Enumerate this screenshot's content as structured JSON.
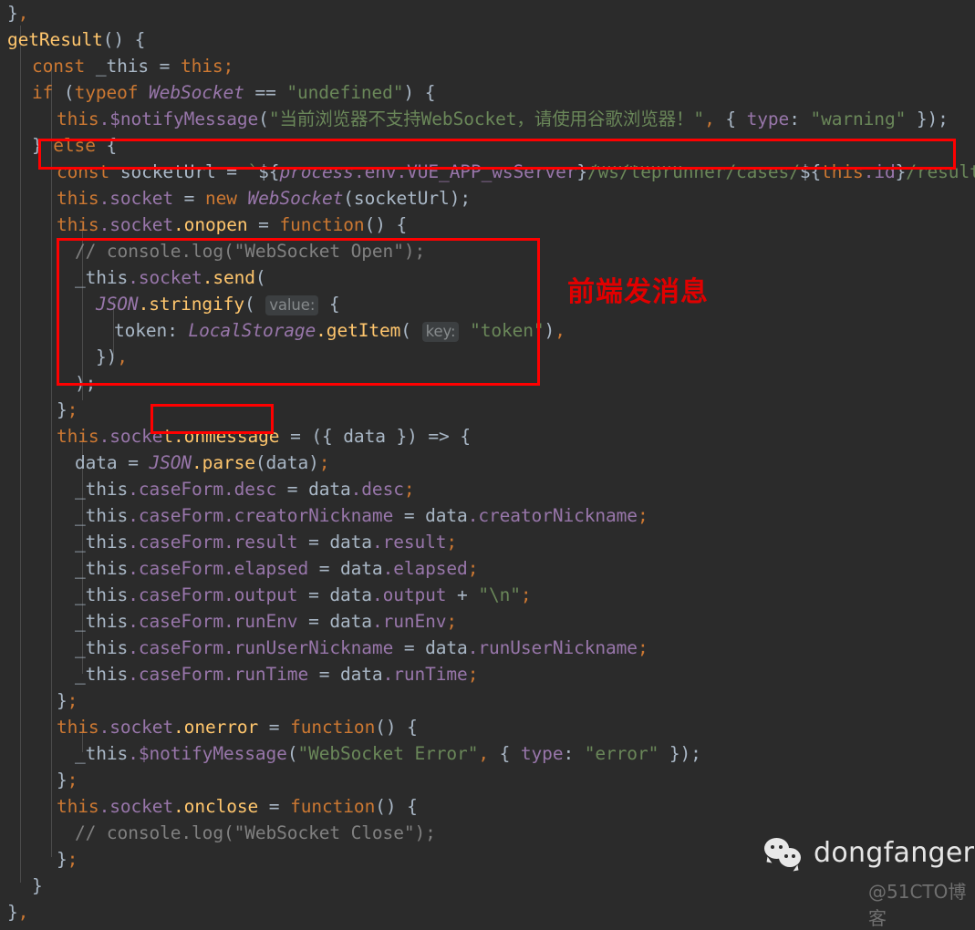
{
  "editor": {
    "background": "#2b2b2b",
    "default_text_color": "#a9b7c6",
    "language": "javascript"
  },
  "code_lines": [
    {
      "id": "l1",
      "text": "},",
      "indent": 0
    },
    {
      "id": "l2",
      "text": "getResult() {",
      "indent": 0
    },
    {
      "id": "l3",
      "text": "const _this = this;",
      "indent": 1
    },
    {
      "id": "l4",
      "text": "if (typeof WebSocket == \"undefined\") {",
      "indent": 1
    },
    {
      "id": "l5",
      "text": "this.$notifyMessage(\"当前浏览器不支持WebSocket，请使用谷歌浏览器！\", { type: \"warning\" });",
      "indent": 2
    },
    {
      "id": "l6",
      "text": "} else {",
      "indent": 1
    },
    {
      "id": "l7",
      "text": "const socketUrl = `${process.env.VUE_APP_wsServer}/ws/teprunner/cases/${this.id}/result/`;",
      "indent": 2
    },
    {
      "id": "l8",
      "text": "this.socket = new WebSocket(socketUrl);",
      "indent": 2
    },
    {
      "id": "l9",
      "text": "this.socket.onopen = function() {",
      "indent": 2
    },
    {
      "id": "l10",
      "text": "// console.log(\"WebSocket Open\");",
      "indent": 3
    },
    {
      "id": "l11",
      "text": "_this.socket.send(",
      "indent": 3
    },
    {
      "id": "l12",
      "text": "JSON.stringify( value: {",
      "indent": 4
    },
    {
      "id": "l13",
      "text": "token: LocalStorage.getItem( key: \"token\"),",
      "indent": 5
    },
    {
      "id": "l14",
      "text": "}),",
      "indent": 4
    },
    {
      "id": "l15",
      "text": ");",
      "indent": 3
    },
    {
      "id": "l16",
      "text": "};",
      "indent": 2
    },
    {
      "id": "l17",
      "text": "this.socket.onmessage = ({ data }) => {",
      "indent": 2
    },
    {
      "id": "l18",
      "text": "data = JSON.parse(data);",
      "indent": 3
    },
    {
      "id": "l19",
      "text": "_this.caseForm.desc = data.desc;",
      "indent": 3
    },
    {
      "id": "l20",
      "text": "_this.caseForm.creatorNickname = data.creatorNickname;",
      "indent": 3
    },
    {
      "id": "l21",
      "text": "_this.caseForm.result = data.result;",
      "indent": 3
    },
    {
      "id": "l22",
      "text": "_this.caseForm.elapsed = data.elapsed;",
      "indent": 3
    },
    {
      "id": "l23",
      "text": "_this.caseForm.output = data.output + \"\\n\";",
      "indent": 3
    },
    {
      "id": "l24",
      "text": "_this.caseForm.runEnv = data.runEnv;",
      "indent": 3
    },
    {
      "id": "l25",
      "text": "_this.caseForm.runUserNickname = data.runUserNickname;",
      "indent": 3
    },
    {
      "id": "l26",
      "text": "_this.caseForm.runTime = data.runTime;",
      "indent": 3
    },
    {
      "id": "l27",
      "text": "};",
      "indent": 2
    },
    {
      "id": "l28",
      "text": "this.socket.onerror = function() {",
      "indent": 2
    },
    {
      "id": "l29",
      "text": "_this.$notifyMessage(\"WebSocket Error\", { type: \"error\" });",
      "indent": 3
    },
    {
      "id": "l30",
      "text": "};",
      "indent": 2
    },
    {
      "id": "l31",
      "text": "this.socket.onclose = function() {",
      "indent": 2
    },
    {
      "id": "l32",
      "text": "// console.log(\"WebSocket Close\");",
      "indent": 3
    },
    {
      "id": "l33",
      "text": "};",
      "indent": 2
    },
    {
      "id": "l34",
      "text": "}",
      "indent": 1
    },
    {
      "id": "l35",
      "text": "},",
      "indent": 0
    }
  ],
  "inline_hints": [
    {
      "id": "hint-value",
      "label": "value:"
    },
    {
      "id": "hint-key",
      "label": "key:"
    }
  ],
  "annotations": {
    "color": "#ff0000",
    "boxes": [
      {
        "id": "box-socket-url",
        "target": "const socketUrl line"
      },
      {
        "id": "box-socket-send",
        "target": "_this.socket.send block"
      },
      {
        "id": "box-onmessage",
        "target": "t.onmessage"
      }
    ],
    "note": {
      "id": "note-frontend-send",
      "text": "前端发消息"
    }
  },
  "watermark": {
    "icon": "wechat-icon",
    "name": "dongfanger",
    "site": "@51CTO博客"
  }
}
